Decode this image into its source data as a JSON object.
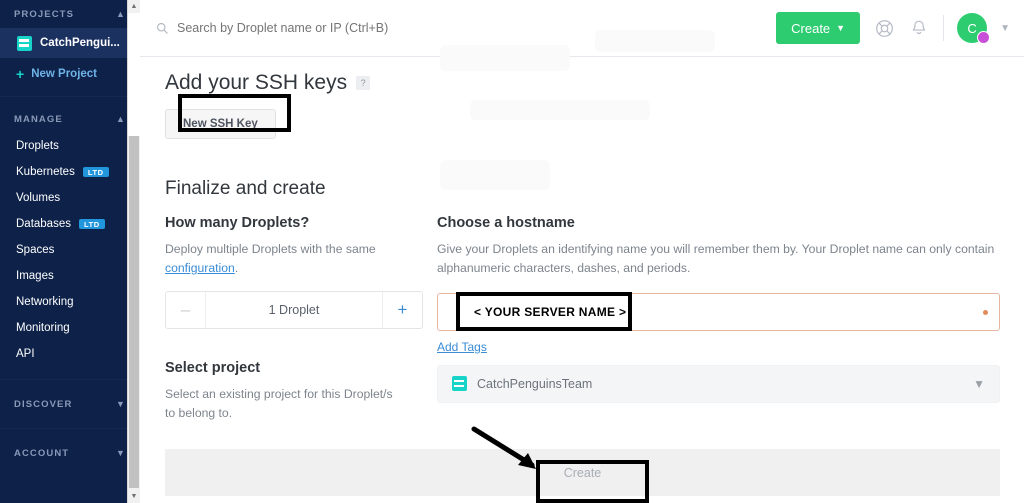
{
  "sidebar": {
    "sections": [
      {
        "title": "PROJECTS",
        "chevron": "chevron-up",
        "project": {
          "label": "CatchPengui...",
          "icon": "project-icon"
        },
        "new_project": {
          "label": "New Project",
          "icon": "plus-icon"
        }
      },
      {
        "title": "MANAGE",
        "chevron": "chevron-up",
        "items": [
          {
            "label": "Droplets",
            "badge": ""
          },
          {
            "label": "Kubernetes",
            "badge": "LTD"
          },
          {
            "label": "Volumes",
            "badge": ""
          },
          {
            "label": "Databases",
            "badge": "LTD"
          },
          {
            "label": "Spaces",
            "badge": ""
          },
          {
            "label": "Images",
            "badge": ""
          },
          {
            "label": "Networking",
            "badge": ""
          },
          {
            "label": "Monitoring",
            "badge": ""
          },
          {
            "label": "API",
            "badge": ""
          }
        ]
      },
      {
        "title": "DISCOVER",
        "chevron": "chevron-down",
        "items": []
      },
      {
        "title": "ACCOUNT",
        "chevron": "chevron-down",
        "items": []
      }
    ]
  },
  "topbar": {
    "search_placeholder": "Search by Droplet name or IP (Ctrl+B)",
    "create_label": "Create",
    "create_chevron": "⌄",
    "help_icon": "lifering-icon",
    "bell_icon": "bell-icon",
    "avatar_initial": "C"
  },
  "ssh": {
    "heading": "Add your SSH keys",
    "help_glyph": "?",
    "new_key_label": "New SSH Key"
  },
  "finalize": {
    "heading": "Finalize and create",
    "droplets": {
      "title": "How many Droplets?",
      "desc_before": "Deploy multiple Droplets with the same",
      "desc_link": "configuration",
      "desc_after": ".",
      "minus": "–",
      "value": "1 Droplet",
      "plus": "+"
    },
    "hostname": {
      "title": "Choose a hostname",
      "desc": "Give your Droplets an identifying name you will remember them by. Your Droplet name can only contain alphanumeric characters, dashes, and periods.",
      "value": "",
      "placeholder": "",
      "add_tags": "Add Tags"
    },
    "project": {
      "title": "Select project",
      "desc": "Select an existing project for this Droplet/s to belong to.",
      "selected": "CatchPenguinsTeam",
      "chevron": "⌄"
    }
  },
  "footer": {
    "create_label": "Create"
  },
  "annotations": {
    "server_name_label": "< YOUR SERVER NAME >"
  },
  "colors": {
    "sidebar_bg": "#0d2149",
    "accent_green": "#2ecc71",
    "link_blue": "#3a8cd6",
    "badge_blue": "#2196dd",
    "project_teal": "#18d4c8",
    "avatar_badge": "#c850d8",
    "input_warn_border": "#e6b8a2"
  }
}
